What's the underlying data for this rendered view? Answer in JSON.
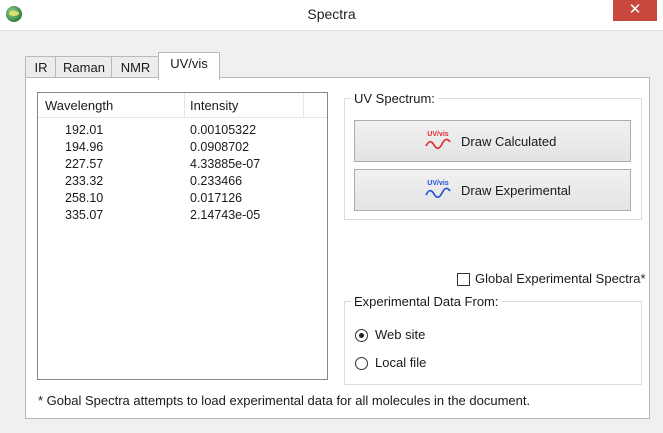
{
  "window": {
    "title": "Spectra",
    "close_label": "✕"
  },
  "tabs": [
    {
      "label": "IR"
    },
    {
      "label": "Raman"
    },
    {
      "label": "NMR"
    },
    {
      "label": "UV/vis"
    }
  ],
  "list": {
    "col_wavelength": "Wavelength",
    "col_intensity": "Intensity",
    "rows": [
      {
        "wavelength": "192.01",
        "intensity": "0.00105322"
      },
      {
        "wavelength": "194.96",
        "intensity": "0.0908702"
      },
      {
        "wavelength": "227.57",
        "intensity": "4.33885e-07"
      },
      {
        "wavelength": "233.32",
        "intensity": "0.233466"
      },
      {
        "wavelength": "258.10",
        "intensity": "0.017126"
      },
      {
        "wavelength": "335.07",
        "intensity": "2.14743e-05"
      }
    ]
  },
  "uv_spectrum": {
    "group_label": "UV Spectrum:",
    "icon_text": "UV/vis",
    "calc_label": "Draw Calculated",
    "exp_label": "Draw Experimental"
  },
  "global_checkbox": {
    "label": "Global Experimental Spectra*",
    "checked": false
  },
  "experimental": {
    "group_label": "Experimental Data From:",
    "web_label": "Web site",
    "local_label": "Local file",
    "selected": "Web site"
  },
  "footnote": "* Gobal Spectra attempts to load experimental data for all molecules in the document.",
  "colors": {
    "calc_icon": "#e0282e",
    "exp_icon": "#1f4fd6",
    "close_bg": "#c9473d"
  }
}
